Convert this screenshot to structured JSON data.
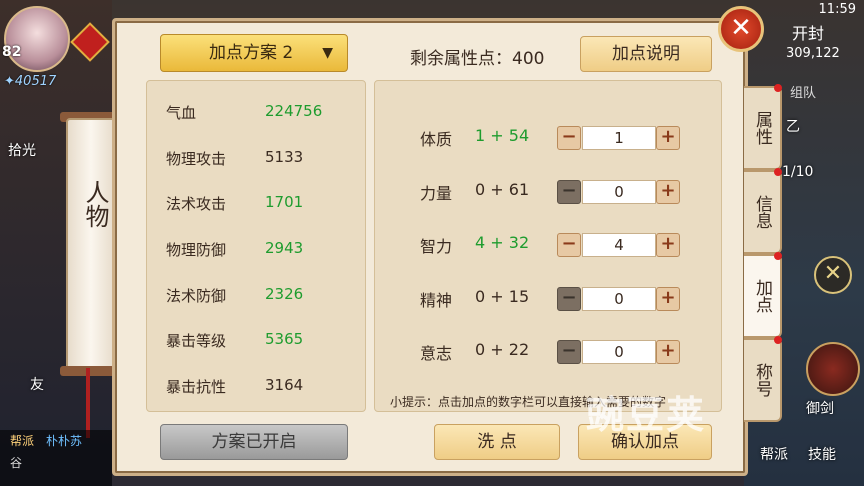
{
  "status": {
    "time": "11:59"
  },
  "player": {
    "level": "82",
    "power": "40517"
  },
  "left_hud": {
    "pickup_label": "拾光",
    "scroll_title": "人物",
    "friend_label": "友"
  },
  "chat": {
    "tag": "帮派",
    "name": "朴朴苏",
    "line": "谷"
  },
  "right_hud": {
    "city": "开封",
    "coords": "309,122",
    "team_label": "组队",
    "bag_label": "御剑",
    "guild_label": "帮派",
    "skill_label": "技能",
    "quest_frag": "乙",
    "progress_frag": "1/10"
  },
  "panel": {
    "scheme_select": "加点方案 2",
    "remaining_label": "剩余属性点：",
    "remaining_value": "400",
    "help_button": "加点说明",
    "stats": [
      {
        "name": "气血",
        "value": "224756",
        "color": "green"
      },
      {
        "name": "物理攻击",
        "value": "5133",
        "color": "dark"
      },
      {
        "name": "法术攻击",
        "value": "1701",
        "color": "green"
      },
      {
        "name": "物理防御",
        "value": "2943",
        "color": "green"
      },
      {
        "name": "法术防御",
        "value": "2326",
        "color": "green"
      },
      {
        "name": "暴击等级",
        "value": "5365",
        "color": "green"
      },
      {
        "name": "暴击抗性",
        "value": "3164",
        "color": "dark"
      }
    ],
    "attributes": [
      {
        "name": "体质",
        "value": "1 + 54",
        "input": "1",
        "minus_enabled": true,
        "color": "green"
      },
      {
        "name": "力量",
        "value": "0 + 61",
        "input": "0",
        "minus_enabled": false,
        "color": "dark"
      },
      {
        "name": "智力",
        "value": "4 + 32",
        "input": "4",
        "minus_enabled": true,
        "color": "green"
      },
      {
        "name": "精神",
        "value": "0 + 15",
        "input": "0",
        "minus_enabled": false,
        "color": "dark"
      },
      {
        "name": "意志",
        "value": "0 + 22",
        "input": "0",
        "minus_enabled": false,
        "color": "dark"
      }
    ],
    "tip": "小提示：点击加点的数字栏可以直接输入需要的数字",
    "scheme_enabled_button": "方案已开启",
    "wash_button": "洗 点",
    "confirm_button": "确认加点"
  },
  "tabs": [
    {
      "label": "属性",
      "active": false
    },
    {
      "label": "信息",
      "active": false
    },
    {
      "label": "加点",
      "active": true
    },
    {
      "label": "称号",
      "active": false
    }
  ],
  "watermark": "豌豆荚",
  "colors": {
    "green": "#1e9c2e",
    "panel_bg": "#f3ead9",
    "button_gold": "#eab93a",
    "close_red": "#c82a16"
  }
}
